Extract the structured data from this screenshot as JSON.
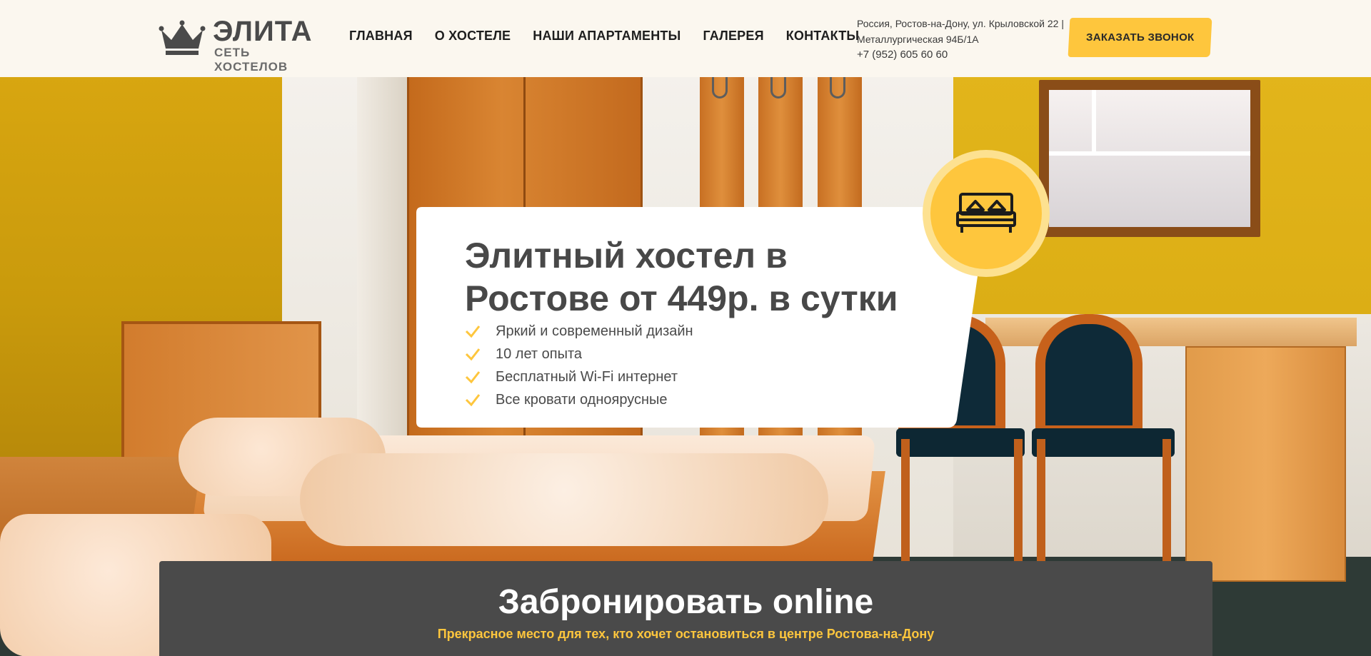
{
  "logo": {
    "title": "ЭЛИТА",
    "subtitle": "СЕТЬ ХОСТЕЛОВ"
  },
  "nav": {
    "items": [
      {
        "label": "ГЛАВНАЯ"
      },
      {
        "label": "О ХОСТЕЛЕ"
      },
      {
        "label": "НАШИ АПАРТАМЕНТЫ"
      },
      {
        "label": "ГАЛЕРЕЯ"
      },
      {
        "label": "КОНТАКТЫ"
      }
    ]
  },
  "contacts": {
    "address_line1": "Россия, Ростов-на-Дону, ул. Крыловской 22 |",
    "address_line2": "Металлургическая 94Б/1А",
    "phone": "+7 (952) 605 60 60"
  },
  "callback_button": {
    "label": "ЗАКАЗАТЬ ЗВОНОК"
  },
  "hero": {
    "title_line1": "Элитный хостел в",
    "title_line2": "Ростове от 449р. в сутки",
    "features": [
      "Яркий и современный дизайн",
      "10 лет опыта",
      "Бесплатный Wi-Fi интернет",
      "Все кровати одноярусные"
    ],
    "badge_icon": "bed-icon"
  },
  "booking": {
    "title": "Забронировать online",
    "subtitle": "Прекрасное место для тех, кто хочет остановиться в центре Ростова-на-Дону"
  },
  "colors": {
    "accent": "#fec63d",
    "dark": "#4a4a4a",
    "header_bg": "#fbf7ef"
  }
}
